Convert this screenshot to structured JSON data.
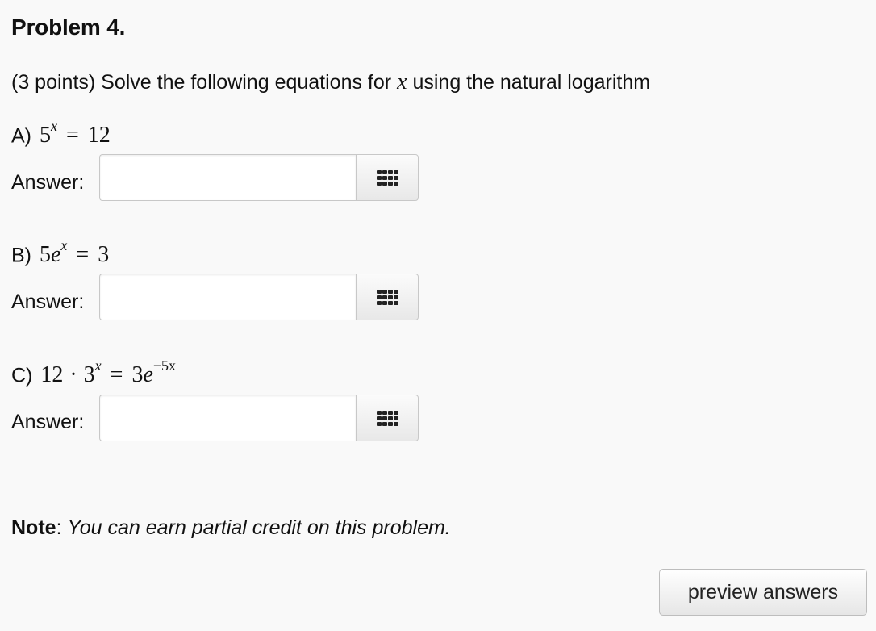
{
  "problem": {
    "title": "Problem 4.",
    "intro_prefix": "(3 points) Solve the following equations for",
    "intro_var": "x",
    "intro_suffix": "using the natural logarithm"
  },
  "parts": [
    {
      "label": "A)",
      "lhs_base": "5",
      "lhs_exp": "x",
      "equals": "=",
      "rhs": "12",
      "answer_label": "Answer:",
      "answer_value": ""
    },
    {
      "label": "B)",
      "lhs_coef": "5",
      "lhs_base": "e",
      "lhs_exp": "x",
      "equals": "=",
      "rhs": "3",
      "answer_label": "Answer:",
      "answer_value": ""
    },
    {
      "label": "C)",
      "lhs_coef": "12",
      "dot": "·",
      "lhs_base": "3",
      "lhs_exp": "x",
      "equals": "=",
      "rhs_coef": "3",
      "rhs_base": "e",
      "rhs_exp": "−5x",
      "answer_label": "Answer:",
      "answer_value": ""
    }
  ],
  "note": {
    "label": "Note",
    "colon": ":",
    "text": "You can earn partial credit on this problem."
  },
  "buttons": {
    "preview": "preview answers",
    "editor_icon": "equation-editor-grid-icon"
  }
}
